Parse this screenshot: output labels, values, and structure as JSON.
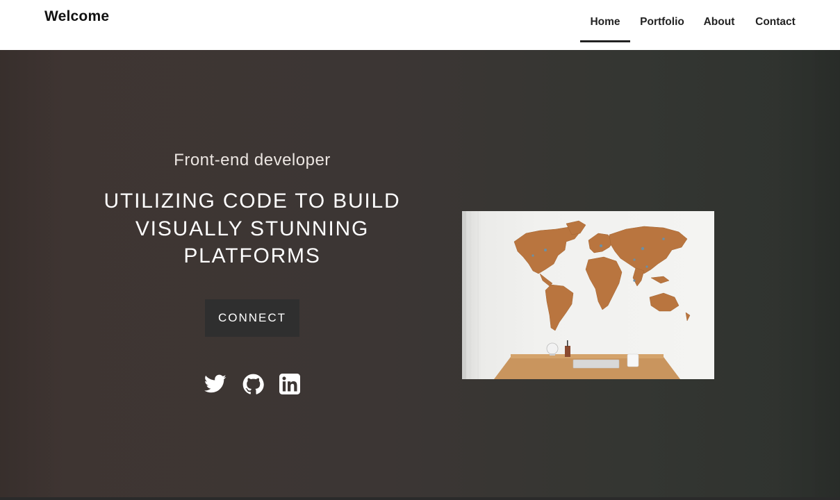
{
  "brand": "Welcome",
  "nav": {
    "items": [
      {
        "label": "Home",
        "active": true
      },
      {
        "label": "Portfolio",
        "active": false
      },
      {
        "label": "About",
        "active": false
      },
      {
        "label": "Contact",
        "active": false
      }
    ]
  },
  "hero": {
    "subtitle": "Front-end developer",
    "headline": "UTILIZING CODE TO BUILD VISUALLY STUNNING PLATFORMS",
    "cta_label": "CONNECT",
    "social": [
      {
        "icon": "twitter-icon"
      },
      {
        "icon": "github-icon"
      },
      {
        "icon": "linkedin-icon"
      }
    ]
  },
  "colors": {
    "hero_bg_left": "#3f3532",
    "hero_bg_right": "#2e322e",
    "button_bg": "#2f2f2f",
    "text_light": "#ffffff",
    "map_cork": "#b9753f"
  }
}
